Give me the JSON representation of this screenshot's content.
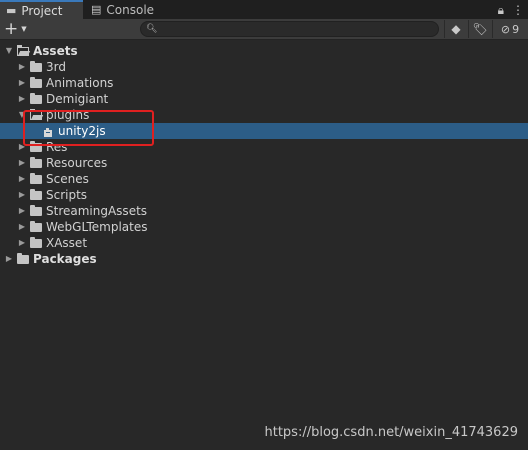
{
  "tabs": [
    {
      "label": "Project",
      "icon": "folder-icon",
      "active": true
    },
    {
      "label": "Console",
      "icon": "console-icon",
      "active": false
    }
  ],
  "toolbar": {
    "add_label": "+",
    "search_placeholder": "",
    "search_value": "",
    "hidden_count": "9"
  },
  "tree": {
    "assets": {
      "label": "Assets",
      "expanded": true
    },
    "items": [
      {
        "label": "3rd",
        "depth": 1,
        "type": "folder",
        "expanded": false
      },
      {
        "label": "Animations",
        "depth": 1,
        "type": "folder",
        "expanded": false
      },
      {
        "label": "Demigiant",
        "depth": 1,
        "type": "folder",
        "expanded": false
      },
      {
        "label": "plugins",
        "depth": 1,
        "type": "folder",
        "expanded": true
      },
      {
        "label": "unity2js",
        "depth": 2,
        "type": "plugin",
        "selected": true
      },
      {
        "label": "Res",
        "depth": 1,
        "type": "folder",
        "expanded": false
      },
      {
        "label": "Resources",
        "depth": 1,
        "type": "folder",
        "expanded": false
      },
      {
        "label": "Scenes",
        "depth": 1,
        "type": "folder",
        "expanded": false
      },
      {
        "label": "Scripts",
        "depth": 1,
        "type": "folder",
        "expanded": false
      },
      {
        "label": "StreamingAssets",
        "depth": 1,
        "type": "folder",
        "expanded": false
      },
      {
        "label": "WebGLTemplates",
        "depth": 1,
        "type": "folder",
        "expanded": false
      },
      {
        "label": "XAsset",
        "depth": 1,
        "type": "folder",
        "expanded": false
      }
    ],
    "packages": {
      "label": "Packages",
      "expanded": false
    }
  },
  "colors": {
    "selection": "#2c5d87",
    "highlight_box": "#e02020",
    "background": "#282828",
    "tab_accent": "#3a79bb"
  },
  "watermark": "https://blog.csdn.net/weixin_41743629"
}
